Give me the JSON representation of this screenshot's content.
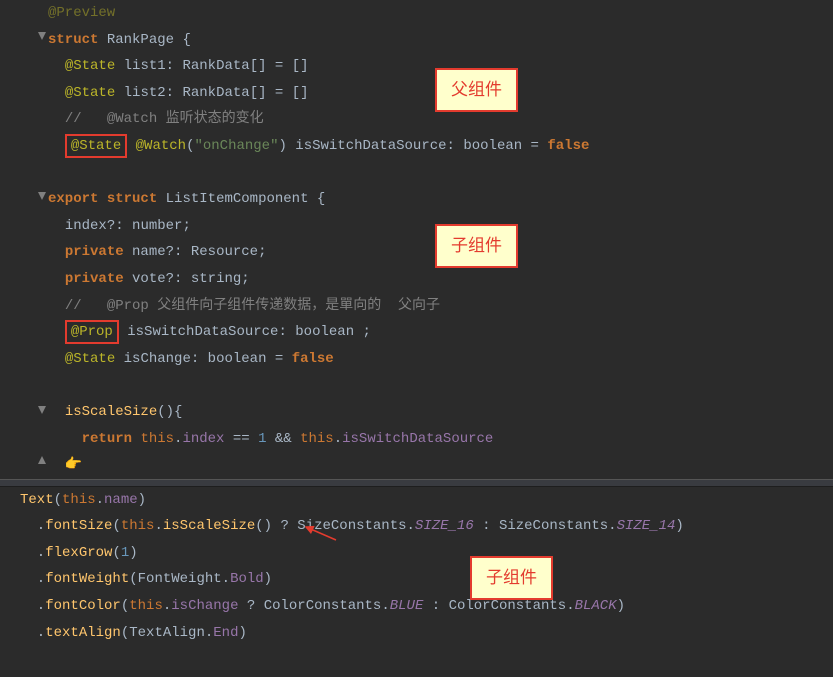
{
  "block1": {
    "l1_deco": "@Preview",
    "l2_kw": "struct",
    "l2_name": "RankPage",
    "l3_deco": "@State",
    "l3_id": "list1",
    "l3_type": "RankData",
    "l4_deco": "@State",
    "l4_id": "list2",
    "l4_type": "RankData",
    "l5_cmt": "//   @Watch 监听状态的变化",
    "l6_deco1": "@State",
    "l6_deco2": "@Watch",
    "l6_str": "\"onChange\"",
    "l6_id": "isSwitchDataSource",
    "l6_type": "boolean",
    "l6_val": "false",
    "l7_kw1": "export",
    "l7_kw2": "struct",
    "l7_name": "ListItemComponent",
    "l8_id": "index",
    "l8_type": "number",
    "l9_kw": "private",
    "l9_id": "name",
    "l9_type": "Resource",
    "l10_kw": "private",
    "l10_id": "vote",
    "l10_type": "string",
    "l11_cmt": "//   @Prop 父组件向子组件传递数据，是單向的  父向子",
    "l12_deco": "@Prop",
    "l12_id": "isSwitchDataSource",
    "l12_type": "boolean",
    "l13_deco": "@State",
    "l13_id": "isChange",
    "l13_type": "boolean",
    "l13_val": "false",
    "l14_func": "isScaleSize",
    "l15_kw": "return",
    "l15_this": "this",
    "l15_m1": "index",
    "l15_num": "1",
    "l15_this2": "this",
    "l15_m2": "isSwitchDataSource"
  },
  "block2": {
    "l1_fn": "Text",
    "l1_this": "this",
    "l1_m": "name",
    "l2_fn": "fontSize",
    "l2_this": "this",
    "l2_m": "isScaleSize",
    "l2_c1": "SizeConstants",
    "l2_p1": "SIZE_16",
    "l2_c2": "SizeConstants",
    "l2_p2": "SIZE_14",
    "l3_fn": "flexGrow",
    "l3_num": "1",
    "l4_fn": "fontWeight",
    "l4_c": "FontWeight",
    "l4_p": "Bold",
    "l5_fn": "fontColor",
    "l5_this": "this",
    "l5_m": "isChange",
    "l5_c1": "ColorConstants",
    "l5_p1": "BLUE",
    "l5_c2": "ColorConstants",
    "l5_p2": "BLACK",
    "l6_fn": "textAlign",
    "l6_c": "TextAlign",
    "l6_p": "End"
  },
  "annotations": {
    "a1": "父组件",
    "a2": "子组件",
    "a3": "子组件"
  }
}
